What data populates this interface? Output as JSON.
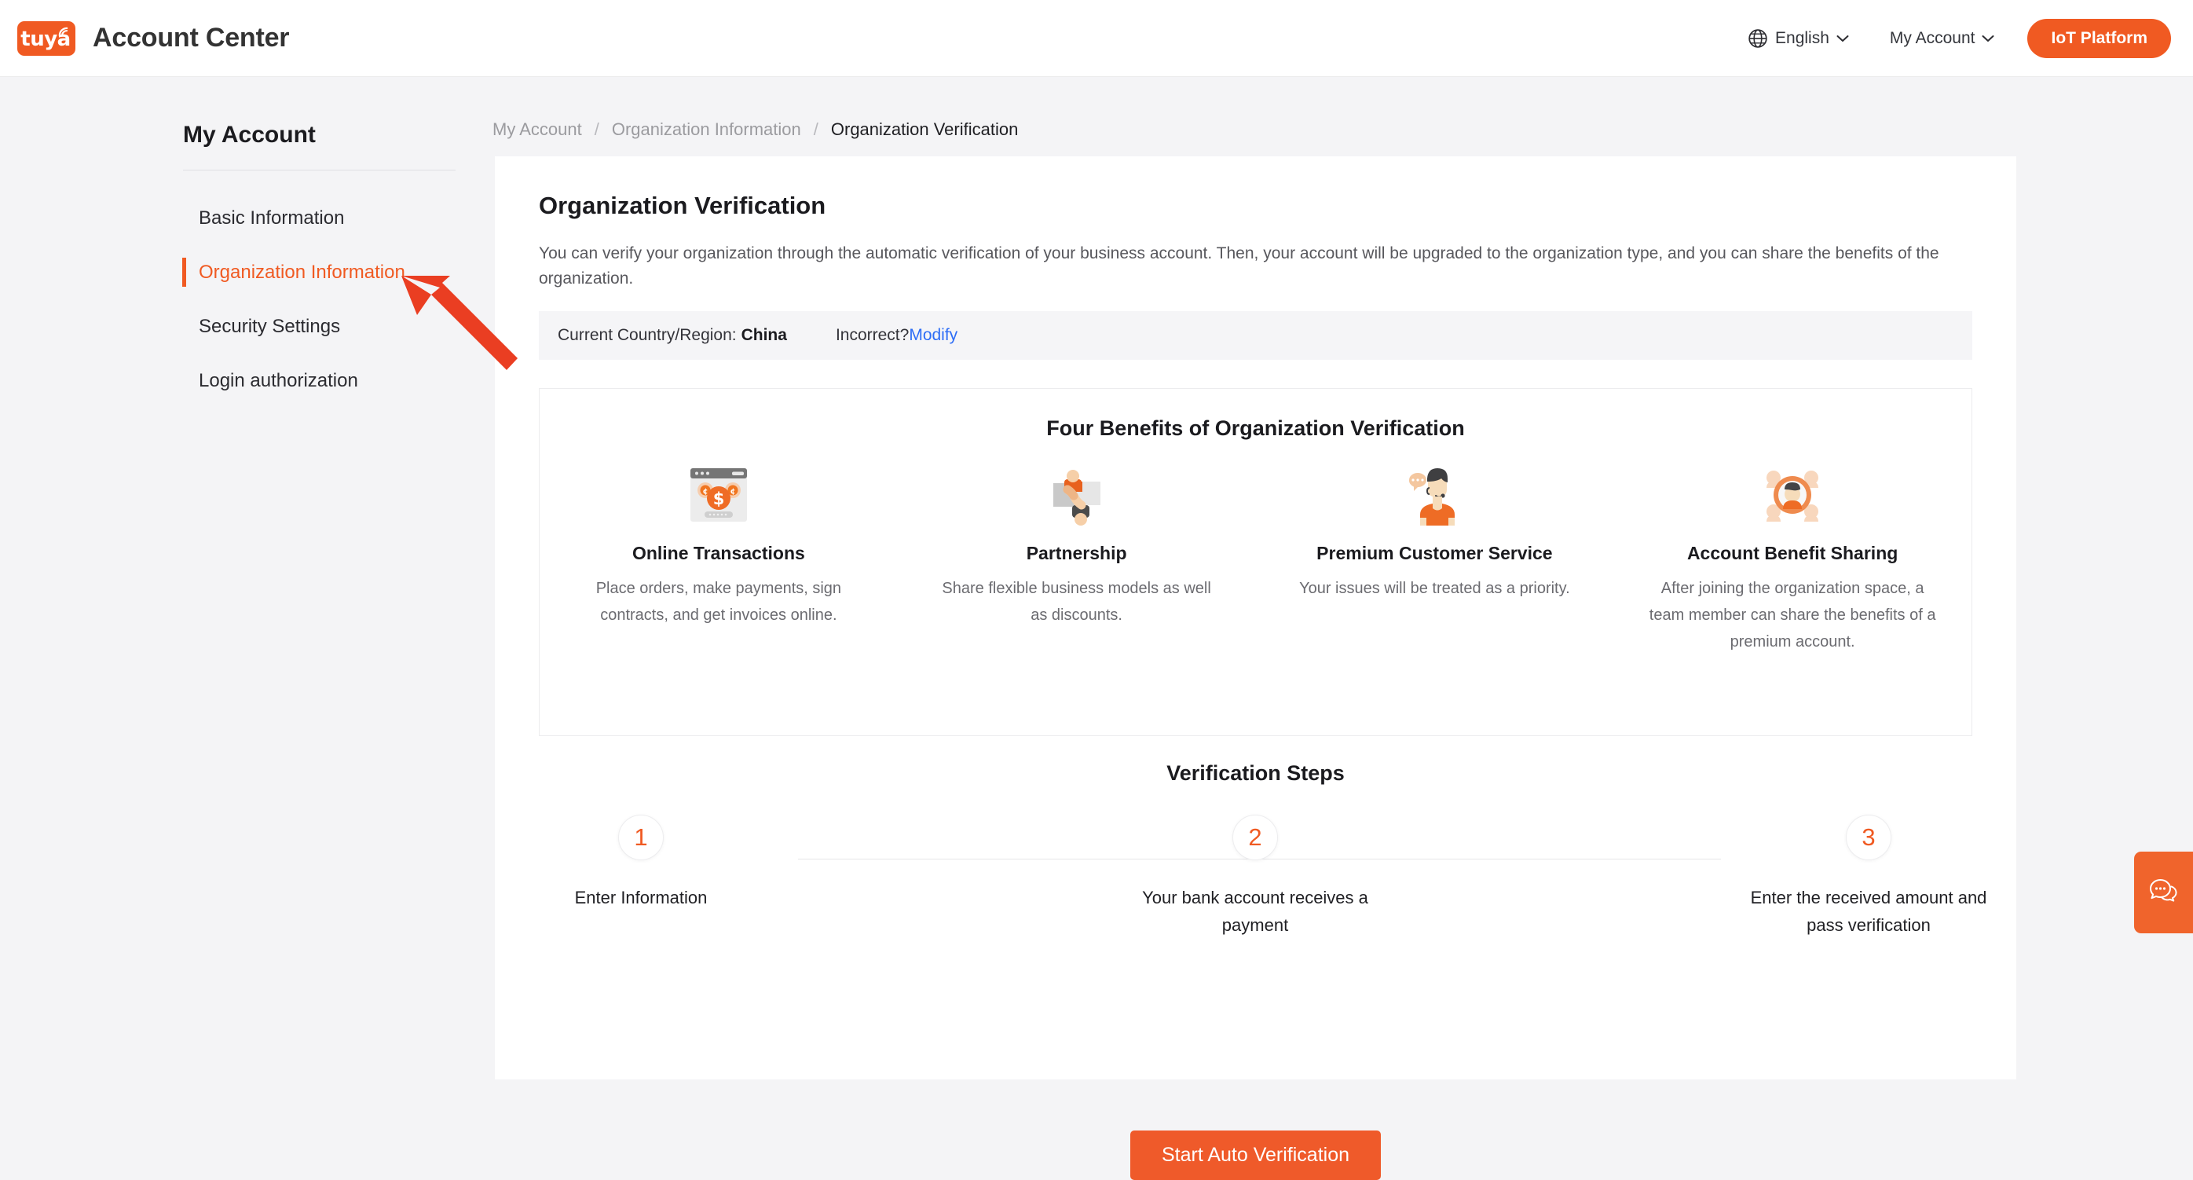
{
  "header": {
    "logo_text": "tuya",
    "app_title": "Account Center",
    "language": "English",
    "account_menu": "My Account",
    "iot_platform_button": "IoT Platform"
  },
  "sidebar": {
    "title": "My Account",
    "items": [
      {
        "label": "Basic Information",
        "active": false
      },
      {
        "label": "Organization Information",
        "active": true
      },
      {
        "label": "Security Settings",
        "active": false
      },
      {
        "label": "Login authorization",
        "active": false
      }
    ]
  },
  "breadcrumb": {
    "items": [
      "My Account",
      "Organization Information",
      "Organization Verification"
    ],
    "separator": "/"
  },
  "main": {
    "page_title": "Organization Verification",
    "description": "You can verify your organization through the automatic verification of your business account. Then, your account will be upgraded to the organization type, and you can share the benefits of the organization.",
    "country_bar": {
      "label": "Current Country/Region:",
      "value": "China",
      "incorrect_text": "Incorrect?",
      "modify_link": "Modify"
    },
    "benefits_title": "Four Benefits of Organization Verification",
    "benefits": [
      {
        "icon": "online-transactions-icon",
        "title": "Online Transactions",
        "desc": "Place orders, make payments, sign contracts, and get invoices online."
      },
      {
        "icon": "partnership-icon",
        "title": "Partnership",
        "desc": "Share flexible business models as well as discounts."
      },
      {
        "icon": "customer-service-icon",
        "title": "Premium Customer Service",
        "desc": "Your issues will be treated as a priority."
      },
      {
        "icon": "benefit-sharing-icon",
        "title": "Account Benefit Sharing",
        "desc": "After joining the organization space, a team member can share the benefits of a premium account."
      }
    ],
    "steps_title": "Verification Steps",
    "steps": [
      {
        "number": "1",
        "label": "Enter Information"
      },
      {
        "number": "2",
        "label": "Your bank account receives a payment"
      },
      {
        "number": "3",
        "label": "Enter the received amount and pass verification"
      }
    ],
    "start_button": "Start Auto Verification"
  },
  "chat_widget": {
    "icon": "chat-bubble-icon"
  },
  "colors": {
    "brand_orange": "#f05a22",
    "button_orange": "#ef5a2a",
    "link_blue": "#2d6df6",
    "page_bg": "#f4f4f6",
    "annotation_red": "#ea3e22"
  }
}
